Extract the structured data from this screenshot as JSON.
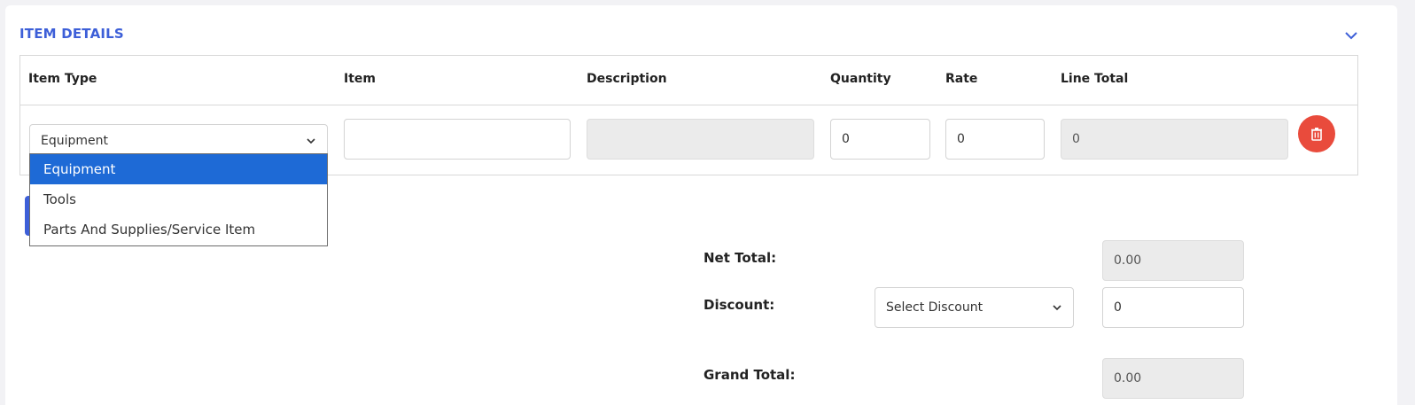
{
  "section": {
    "title": "ITEM DETAILS"
  },
  "table": {
    "headers": {
      "item_type": "Item Type",
      "item": "Item",
      "description": "Description",
      "quantity": "Quantity",
      "rate": "Rate",
      "line_total": "Line Total"
    },
    "row": {
      "item_type_selected": "Equipment",
      "item_value": "",
      "description_value": "",
      "quantity_value": "0",
      "rate_value": "0",
      "line_total_value": "0"
    }
  },
  "item_type_options": [
    "Equipment",
    "Tools",
    "Parts And Supplies/Service Item"
  ],
  "totals": {
    "net_total_label": "Net Total:",
    "net_total_value": "0.00",
    "discount_label": "Discount:",
    "discount_select": "Select Discount",
    "discount_value": "0",
    "grand_total_label": "Grand Total:",
    "grand_total_value": "0.00"
  },
  "icons": {
    "collapse": "chevron-down-icon",
    "delete": "trash-icon",
    "select": "chevron-down-icon"
  },
  "colors": {
    "accent": "#3d5fd8",
    "danger": "#e94b3c",
    "option_active": "#1e6ad6"
  }
}
